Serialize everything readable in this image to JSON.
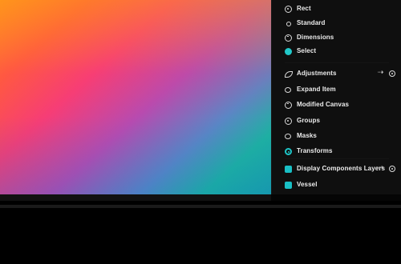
{
  "window": {
    "title": ""
  },
  "preview": {
    "gradient_colors": [
      "#ff8a22",
      "#ff5a3e",
      "#f63d76",
      "#b74bb0",
      "#5b86c5",
      "#1fb2a1",
      "#1ba1a9"
    ]
  },
  "menu": {
    "items": [
      {
        "label": "Rect",
        "icon": "dotted-circle-icon"
      },
      {
        "label": "Standard",
        "icon": "small-dot-icon"
      },
      {
        "label": "Dimensions",
        "icon": "gauge-icon"
      },
      {
        "label": "Select",
        "icon": "cyan-dot-icon"
      },
      {
        "label": "Adjustments",
        "icon": "leaf-icon",
        "has_arrow": true,
        "has_cycle": true
      },
      {
        "label": "Expand Item",
        "icon": "oval-icon"
      },
      {
        "label": "Modified Canvas",
        "icon": "gauge-icon"
      },
      {
        "label": "Groups",
        "icon": "dotted-circle-icon"
      },
      {
        "label": "Masks",
        "icon": "oval-icon"
      },
      {
        "label": "Transforms",
        "icon": "cyan-ring-icon"
      },
      {
        "label": "Display Components Layers",
        "icon": "square-cyan-icon",
        "has_arrow": true,
        "has_cycle": true
      },
      {
        "label": "Vessel",
        "icon": "square-cyan-icon"
      }
    ]
  },
  "colors": {
    "panel_bg": "#0f0f0f",
    "accent_cyan": "#21c8c9",
    "text": "#ececec",
    "bottom_bar": "#000000"
  }
}
